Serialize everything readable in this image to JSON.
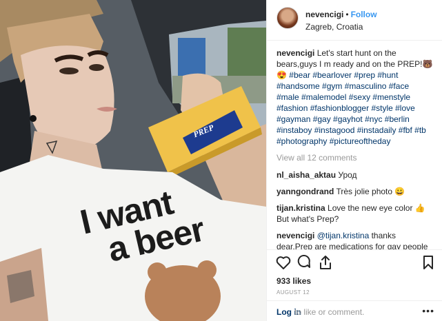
{
  "header": {
    "username": "nevencigi",
    "dot": "•",
    "follow_label": "Follow",
    "location": "Zagreb, Croatia"
  },
  "post": {
    "shirt_line1": "I want",
    "shirt_line2": "a beer",
    "product_label": "PREP",
    "caption_user": "nevencigi",
    "caption_text": "Let's start hunt on the bears,guys I m ready and on the PREP!🐻 😍",
    "hashtags": "#bear #bearlover #prep #hunt #handsome #gym #masculino #face #male #malemodel #sexy #menstyle #fashion #fashionblogger #style #love #gayman #gay #gayhot #nyc #berlin #instaboy #instagood #instadaily #fbf #tb #photography #pictureoftheday"
  },
  "comments": {
    "view_all": "View all 12 comments",
    "items": [
      {
        "user": "nl_aisha_aktau",
        "text": "Урод"
      },
      {
        "user": "yanngondrand",
        "text": "Très jolie photo 😀"
      },
      {
        "user": "tijan.kristina",
        "text": "Love the new eye color 👍 But what's Prep?"
      },
      {
        "user": "nevencigi",
        "mention": "@tijan.kristina",
        "text": "thanks dear.Prep are medications for gay people for having sex without protection.But this what I hold is universal cream for all type of skin damages. They have same name,and I just make it joke 😂 😂"
      }
    ]
  },
  "stats": {
    "likes": "933 likes",
    "date": "AUGUST 12"
  },
  "footer": {
    "login_link": "Log in",
    "login_text": "to like or comment.",
    "more": "•••"
  }
}
